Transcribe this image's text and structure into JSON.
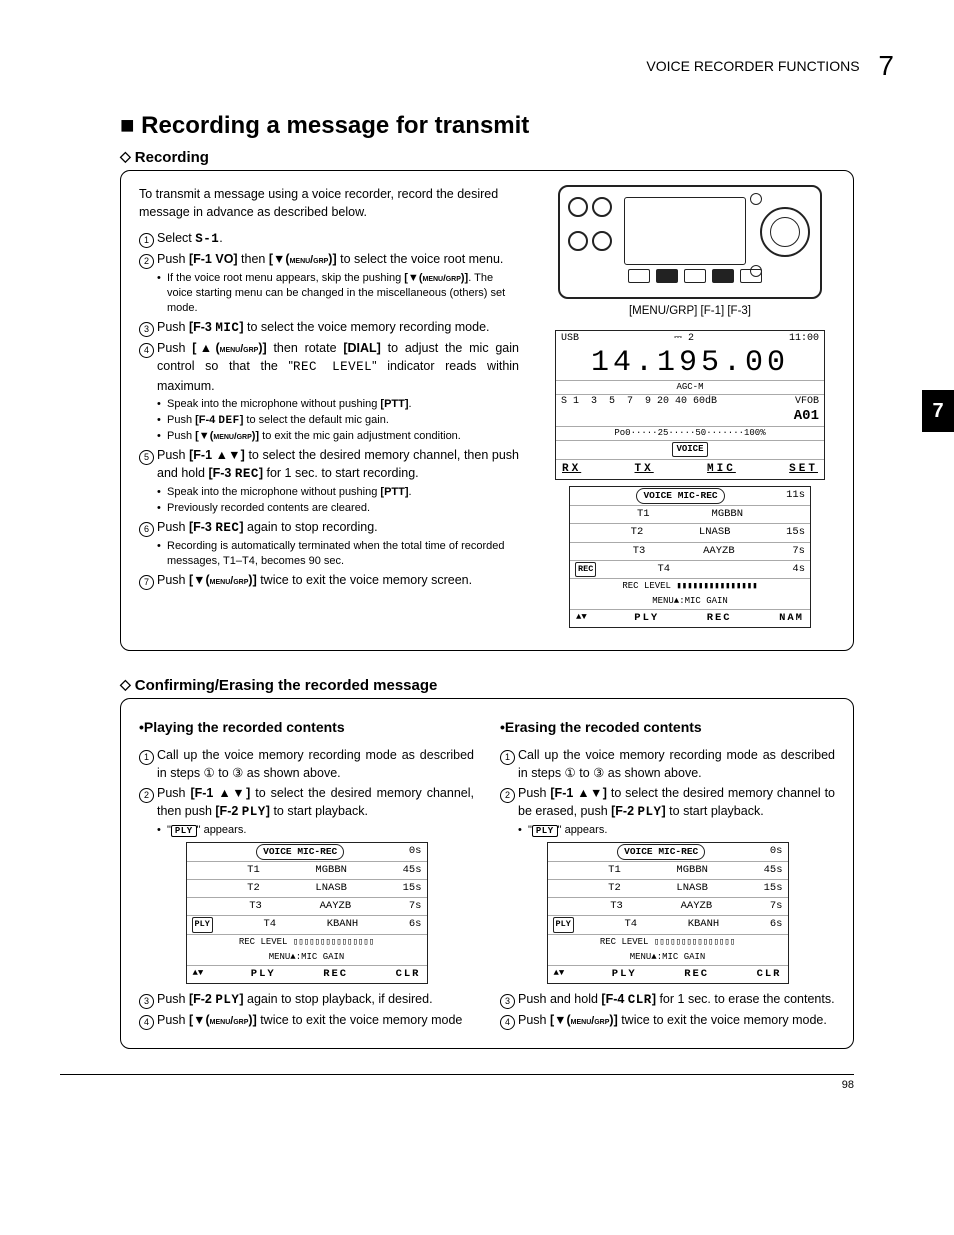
{
  "header": {
    "section": "VOICE RECORDER FUNCTIONS",
    "chapter": "7"
  },
  "sideTab": "7",
  "title": "Recording a message for transmit",
  "sub1": "Recording",
  "intro": "To transmit a message using a voice recorder, record the desired message in advance as described below.",
  "steps1": {
    "s1": "Select ",
    "s1b": "S-1",
    "s1c": ".",
    "s2a": "Push ",
    "s2b": "[F-1 VO]",
    "s2c": " then ",
    "s2d": "[▼(MENU/GRP)]",
    "s2e": " to select the voice root menu.",
    "n2a": "If the voice root menu appears, skip the pushing ",
    "n2b": "[▼(MENU/GRP)]",
    "n2c": ". The voice starting menu can be changed in the miscellaneous (others) set mode.",
    "s3a": "Push ",
    "s3b": "[F-3 MIC]",
    "s3c": " to select the voice memory recording mode.",
    "s4a": "Push ",
    "s4b": "[▲(MENU/GRP)]",
    "s4c": " then rotate ",
    "s4d": "[DIAL]",
    "s4e": " to adjust the mic gain control so that the \"",
    "s4f": "REC LEVEL",
    "s4g": "\" indicator reads within maximum.",
    "n4a": "Speak into the microphone without pushing ",
    "n4b": "[PTT]",
    "n4c": ".",
    "n4d": "Push ",
    "n4e": "[F-4 DEF]",
    "n4f": " to select the default mic gain.",
    "n4g": "Push ",
    "n4h": "[▼(MENU/GRP)]",
    "n4i": " to exit the mic gain adjustment condition.",
    "s5a": "Push ",
    "s5b": "[F-1 ▲▼]",
    "s5c": " to select the desired memory channel, then push and hold ",
    "s5d": "[F-3 REC]",
    "s5e": " for 1 sec. to start recording.",
    "n5a": "Speak into the microphone without pushing ",
    "n5b": "[PTT]",
    "n5c": ".",
    "n5d": "Previously recorded contents are cleared.",
    "s6a": "Push ",
    "s6b": "[F-3 REC]",
    "s6c": " again to stop recording.",
    "n6a": "Recording is automatically terminated when the total time of recorded messages, T1–T4, becomes 90 sec.",
    "s7a": "Push ",
    "s7b": "[▼(MENU/GRP)]",
    "s7c": " twice to exit the voice memory screen."
  },
  "devLabel": "[MENU/GRP] [F-1] [F-3]",
  "lcd1": {
    "mode": "USB",
    "ant": "2",
    "time": "11:00",
    "freq": "14.195.00",
    "agc": "AGC-M",
    "meter1": "S 1  3  5  7  9 20 40 60dB",
    "vfo": "VFOB",
    "mem": "A01",
    "meter2": "Po0·····25·····50·······100%",
    "voice": "VOICE",
    "foot": [
      "RX",
      "TX",
      "MIC",
      "SET"
    ]
  },
  "lcdMini1": {
    "hdr": "VOICE MIC-REC",
    "hdrTime": "11s",
    "rows": [
      {
        "t": "T1",
        "n": "MGBBN",
        "s": ""
      },
      {
        "t": "T2",
        "n": "LNASB",
        "s": "15s"
      },
      {
        "t": "T3",
        "n": "AAYZB",
        "s": "7s"
      },
      {
        "t": "T4",
        "n": "",
        "s": "4s",
        "rec": "REC"
      }
    ],
    "level": "REC LEVEL ▮▮▮▮▮▮▮▮▮▮▮▮▮▮▮",
    "gain": "MENU▲:MIC GAIN",
    "foot": [
      "▲▼",
      "PLY",
      "REC",
      "NAM"
    ]
  },
  "sub2": "Confirming/Erasing the recorded message",
  "play": {
    "head": "•Playing the recorded contents",
    "s1": "Call up the voice memory recording mode as described in steps ① to ③ as shown above.",
    "s2a": "Push ",
    "s2b": "[F-1 ▲▼]",
    "s2c": " to select the desired memory channel, then push ",
    "s2d": "[F-2 PLY]",
    "s2e": " to start playback.",
    "n2": "\" appears.",
    "n2badge": "PLY",
    "s3a": "Push ",
    "s3b": "[F-2 PLY]",
    "s3c": " again to stop playback, if desired.",
    "s4a": "Push ",
    "s4b": "[▼(MENU/GRP)]",
    "s4c": " twice to exit the voice memory mode"
  },
  "erase": {
    "head": "•Erasing the recoded contents",
    "s1": "Call up the voice memory recording mode as described in steps ① to ③ as shown above.",
    "s2a": "Push ",
    "s2b": "[F-1 ▲▼]",
    "s2c": " to select the desired memory channel to be erased, push ",
    "s2d": "[F-2 PLY]",
    "s2e": " to start playback.",
    "n2": "\" appears.",
    "n2badge": "PLY",
    "s3a": "Push and hold ",
    "s3b": "[F-4 CLR]",
    "s3c": " for 1 sec. to erase the contents.",
    "s4a": "Push ",
    "s4b": "[▼(MENU/GRP)]",
    "s4c": " twice to exit the voice memory mode."
  },
  "lcdMini2": {
    "hdr": "VOICE MIC-REC",
    "hdrTime": "0s",
    "rows": [
      {
        "t": "T1",
        "n": "MGBBN",
        "s": "45s"
      },
      {
        "t": "T2",
        "n": "LNASB",
        "s": "15s"
      },
      {
        "t": "T3",
        "n": "AAYZB",
        "s": "7s"
      },
      {
        "t": "T4",
        "n": "KBANH",
        "s": "6s",
        "rec": "PLY"
      }
    ],
    "level": "REC LEVEL ▯▯▯▯▯▯▯▯▯▯▯▯▯▯▯",
    "gain": "MENU▲:MIC GAIN",
    "foot": [
      "▲▼",
      "PLY",
      "REC",
      "CLR"
    ]
  },
  "lcdMini3": {
    "hdr": "VOICE MIC-REC",
    "hdrTime": "0s",
    "rows": [
      {
        "t": "T1",
        "n": "MGBBN",
        "s": "45s"
      },
      {
        "t": "T2",
        "n": "LNASB",
        "s": "15s"
      },
      {
        "t": "T3",
        "n": "AAYZB",
        "s": "7s"
      },
      {
        "t": "T4",
        "n": "KBANH",
        "s": "6s",
        "rec": "PLY"
      }
    ],
    "level": "REC LEVEL ▯▯▯▯▯▯▯▯▯▯▯▯▯▯▯",
    "gain": "MENU▲:MIC GAIN",
    "foot": [
      "▲▼",
      "PLY",
      "REC",
      "CLR"
    ]
  },
  "pageNum": "98"
}
